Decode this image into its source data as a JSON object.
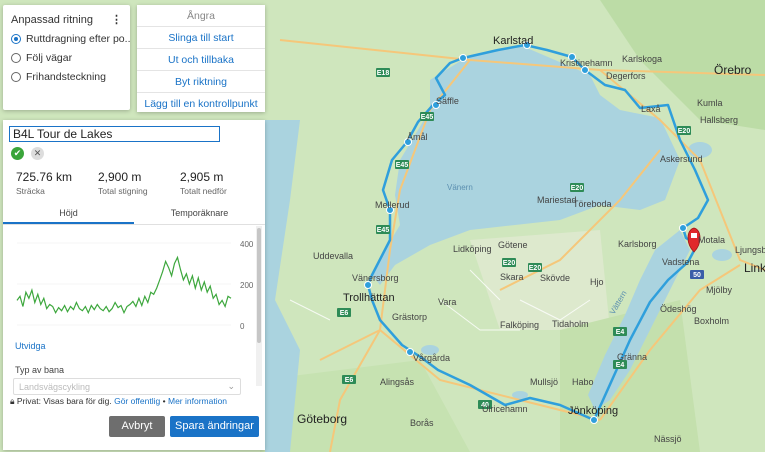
{
  "mode_panel": {
    "title": "Anpassad ritning",
    "options": [
      {
        "label": "Ruttdragning efter po...",
        "selected": true
      },
      {
        "label": "Följ vägar",
        "selected": false
      },
      {
        "label": "Frihandsteckning",
        "selected": false
      }
    ]
  },
  "actions": {
    "undo": "Ångra",
    "loop_to_start": "Slinga till start",
    "out_and_back": "Ut och tillbaka",
    "reverse": "Byt riktning",
    "add_checkpoint": "Lägg till en kontrollpunkt"
  },
  "route": {
    "name": "B4L Tour de Lakes",
    "confirm_icon": "check-icon",
    "discard_icon": "close-icon",
    "stats": [
      {
        "value": "725.76 km",
        "label": "Sträcka"
      },
      {
        "value": "2,900 m",
        "label": "Total stigning"
      },
      {
        "value": "2,905 m",
        "label": "Totalt nedför"
      }
    ],
    "tabs": [
      "Höjd",
      "Temporäknare"
    ],
    "chart_ticks": [
      "400",
      "200",
      "0"
    ],
    "expand": "Utvidga",
    "type_label": "Typ av bana",
    "type_placeholder": "Landsvägscykling",
    "privacy_text": "Privat: Visas bara för dig.",
    "privacy_make_public": "Gör offentlig",
    "privacy_sep": "•",
    "privacy_more": "Mer information",
    "cancel": "Avbryt",
    "save": "Spara ändringar"
  },
  "map": {
    "labels": {
      "karlstad": "Karlstad",
      "kristinehamn": "Kristinehamn",
      "karlskoga": "Karlskoga",
      "orebro": "Örebro",
      "degerfors": "Degerfors",
      "kumla": "Kumla",
      "hallsberg": "Hallsberg",
      "laxa": "Laxå",
      "amal": "Åmål",
      "saffle": "Säffle",
      "vanern": "Vänern",
      "askersund": "Askersund",
      "mariestad": "Mariestad",
      "toreboda": "Töreboda",
      "karlsborg": "Karlsborg",
      "motala": "Motala",
      "vadstena": "Vadstena",
      "linkoping": "Linkö",
      "ljungsbro": "Ljungsbro",
      "mellerud": "Mellerud",
      "lidkoping": "Lidköping",
      "gotene": "Götene",
      "vanersborg": "Vänersborg",
      "trollhattan": "Trollhättan",
      "uddevalla": "Uddevalla",
      "skara": "Skara",
      "skovde": "Skövde",
      "hjo": "Hjo",
      "vattern": "Vättern",
      "mjolby": "Mjölby",
      "boxholm": "Boxholm",
      "odeshog": "Ödeshög",
      "granna": "Gränna",
      "vara": "Vara",
      "falkoping": "Falköping",
      "tidaholm": "Tidaholm",
      "vargarda": "Vårgårda",
      "alingsas": "Alingsås",
      "goteborg": "Göteborg",
      "boras": "Borås",
      "ulricehamn": "Ulricehamn",
      "mullsjo": "Mullsjö",
      "habo": "Habo",
      "jonkoping": "Jönköping",
      "nassjo": "Nässjö",
      "amal_label": "Åmål",
      "grastorp": "Grästorp"
    },
    "road_shields": [
      "E18",
      "E45",
      "E45",
      "E45",
      "E20",
      "E20",
      "E20",
      "E4",
      "E6",
      "E6",
      "40",
      "E4",
      "E20",
      "50"
    ]
  },
  "chart_data": {
    "type": "line",
    "title": "",
    "xlabel": "",
    "ylabel": "",
    "ylim": [
      0,
      400
    ],
    "y_ticks": [
      400,
      200,
      0
    ],
    "series": [
      {
        "values": [
          120,
          140,
          90,
          160,
          130,
          170,
          110,
          150,
          100,
          130,
          80,
          100,
          90,
          60,
          85,
          70,
          95,
          65,
          90,
          75,
          110,
          80,
          70,
          90,
          60,
          95,
          75,
          100,
          80,
          70,
          90,
          65,
          80,
          110,
          85,
          95,
          60,
          90,
          100,
          115,
          90,
          130,
          95,
          140,
          110,
          160,
          150,
          180,
          220,
          260,
          310,
          280,
          240,
          300,
          330,
          270,
          220,
          250,
          200,
          240,
          180,
          230,
          170,
          210,
          160,
          190,
          130,
          150,
          100,
          120,
          90,
          140,
          130
        ]
      }
    ]
  }
}
